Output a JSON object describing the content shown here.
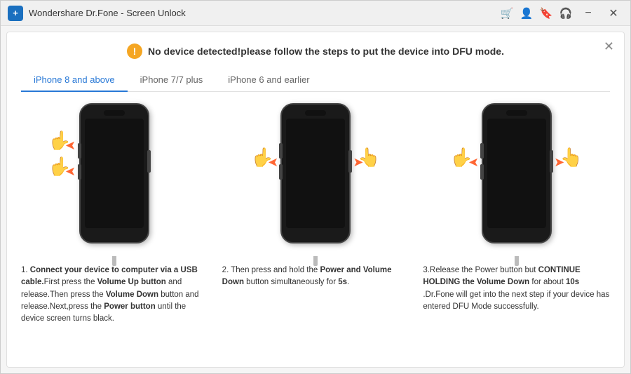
{
  "window": {
    "title": "Wondershare Dr.Fone - Screen Unlock",
    "logo": "+"
  },
  "titlebar": {
    "icons": [
      "cart-icon",
      "user-icon",
      "bookmark-icon",
      "headset-icon"
    ],
    "buttons": [
      "minimize-btn",
      "close-btn"
    ]
  },
  "notice": {
    "text": "No device detected!please follow the steps to put the device into DFU mode."
  },
  "tabs": [
    {
      "id": "tab-iphone8",
      "label": "iPhone 8 and above",
      "active": true
    },
    {
      "id": "tab-iphone7",
      "label": "iPhone 7/7 plus",
      "active": false
    },
    {
      "id": "tab-iphone6",
      "label": "iPhone 6 and earlier",
      "active": false
    }
  ],
  "steps": [
    {
      "number": "1",
      "description_parts": [
        {
          "text": "Connect your device to computer via a USB cable.",
          "bold": true
        },
        {
          "text": "First press the ",
          "bold": false
        },
        {
          "text": "Volume Up button",
          "bold": true
        },
        {
          "text": " and release.Then press the ",
          "bold": false
        },
        {
          "text": "Volume Down",
          "bold": true
        },
        {
          "text": " button and release.Next,press the ",
          "bold": false
        },
        {
          "text": "Power button",
          "bold": true
        },
        {
          "text": " until the device screen turns black.",
          "bold": false
        }
      ]
    },
    {
      "number": "2",
      "description_parts": [
        {
          "text": "Then press and hold the ",
          "bold": false
        },
        {
          "text": "Power and Volume Down",
          "bold": true
        },
        {
          "text": " button simultaneously for ",
          "bold": false
        },
        {
          "text": "5s",
          "bold": true
        },
        {
          "text": ".",
          "bold": false
        }
      ]
    },
    {
      "number": "3",
      "description_parts": [
        {
          "text": "Release the Power button but ",
          "bold": false
        },
        {
          "text": "CONTINUE HOLDING the Volume Down",
          "bold": true
        },
        {
          "text": " for about ",
          "bold": false
        },
        {
          "text": "10s",
          "bold": true
        },
        {
          "text": " .Dr.Fone will get into the next step if your device has entered DFU Mode successfully.",
          "bold": false
        }
      ]
    }
  ]
}
